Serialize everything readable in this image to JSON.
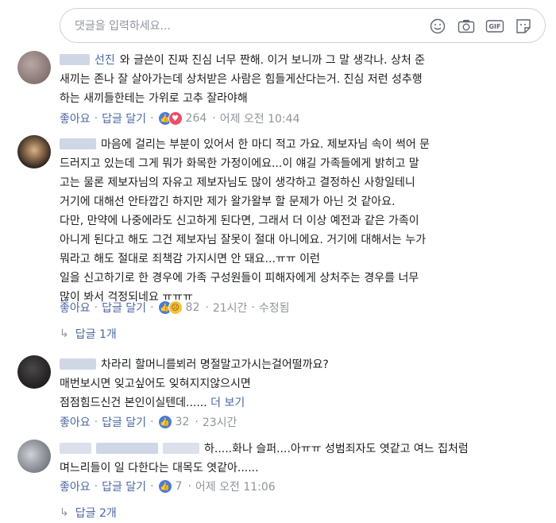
{
  "composer": {
    "placeholder": "댓글을 입력하세요...",
    "icons": [
      "emoji-icon",
      "camera-icon",
      "gif-icon",
      "sticker-icon"
    ],
    "gif_label": "GIF"
  },
  "comments": [
    {
      "author_suffix": "선진",
      "text_lines": [
        "와 글쓴이 진짜 진심 너무 짠해. 이거 보니까 그 말 생각나. 상처 준",
        "새끼는 존나 잘 살아가는데 상처받은 사람은 힘들게산다는거. 진심 저런 성추행",
        "하는 새끼들한테는 가위로 고추 잘라야해"
      ],
      "like_label": "좋아요",
      "reply_label": "답글 달기",
      "reaction_count": "264",
      "time": "어제 오전 10:44"
    },
    {
      "text_lines": [
        "마음에 걸리는 부분이 있어서 한 마디 적고 가요. 제보자님 속이 썩어 문",
        "드러지고 있는데 그게 뭐가 화목한 가정이에요...이 얘길 가족들에게 밝히고 말",
        "고는 물론 제보자님의 자유고 제보자님도 많이 생각하고 결정하신 사항일테니",
        "거기에 대해선 안타깝긴 하지만 제가 왈가왈부 할 문제가 아닌 것 같아요.",
        "다만, 만약에 나중에라도 신고하게 된다면, 그래서 더 이상 예전과 같은 가족이",
        "아니게 된다고 해도 그건 제보자님 잘못이 절대 아니에요. 거기에 대해서는 누가",
        "뭐라고 해도 절대로 죄책감 가지시면 안 돼요...ㅠㅠ 이런",
        "일을 신고하기로 한 경우에 가족 구성원들이 피해자에게 상처주는 경우를 너무",
        "많이 봐서 걱정되네요 ㅠㅠㅠ"
      ],
      "like_label": "좋아요",
      "reply_label": "답글 달기",
      "reaction_count": "82",
      "time": "21시간",
      "edited": "수정됨",
      "replies_label": "답글 1개"
    },
    {
      "text_lines": [
        "차라리 할머니를뵈러 명절말고가시는걸어떨까요?",
        "매번보시면 잊고싶어도 잊혀지지않으시면",
        "점점힘드신건 본인이실텐데......"
      ],
      "more_label": "더 보기",
      "like_label": "좋아요",
      "reply_label": "답글 달기",
      "reaction_count": "32",
      "time": "23시간"
    },
    {
      "text_lines": [
        "하.....화나 슬퍼....아ㅠㅠ 성범죄자도 엿같고 여느 집처럼",
        "며느리들이 일 다한다는 대목도 엿같아......"
      ],
      "like_label": "좋아요",
      "reply_label": "답글 달기",
      "reaction_count": "7",
      "time": "어제 오전 11:06",
      "replies_label": "답글 2개"
    }
  ],
  "separator": "·",
  "colors": {
    "link": "#4b67a1",
    "meta": "#90949c",
    "text": "#1c1e21",
    "like": "#4a7bd6",
    "love": "#e9506a",
    "sad": "#f5c33b"
  }
}
